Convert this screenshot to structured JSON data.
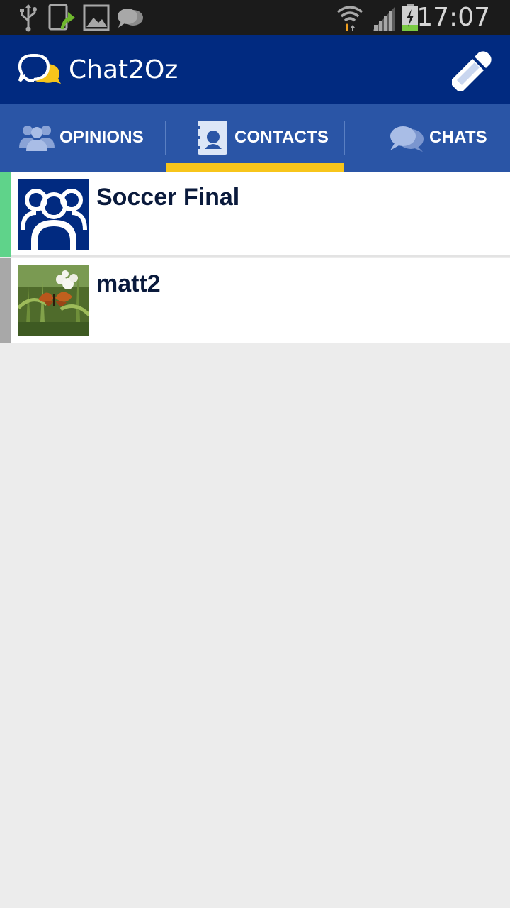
{
  "status_bar": {
    "time": "17:07",
    "left_icons": [
      "usb-icon",
      "screen-share-icon",
      "gallery-icon",
      "chat-notification-icon"
    ],
    "right_icons": [
      "wifi-icon",
      "signal-icon",
      "battery-charging-icon"
    ]
  },
  "app_bar": {
    "title": "Chat2Oz",
    "logo_icon": "chat-bubbles-logo-icon",
    "compose_icon": "pencil-icon"
  },
  "tabs": [
    {
      "label": "OPINIONS",
      "icon": "people-icon",
      "selected": false
    },
    {
      "label": "CONTACTS",
      "icon": "address-book-icon",
      "selected": true
    },
    {
      "label": "CHATS",
      "icon": "chat-bubbles-icon",
      "selected": false
    }
  ],
  "contacts": [
    {
      "name": "Soccer Final",
      "avatar": "group-avatar",
      "status_color": "#5fd38a"
    },
    {
      "name": "matt2",
      "avatar": "photo-avatar-butterfly",
      "status_color": "#a8a8a8"
    }
  ],
  "colors": {
    "status_bar": "#1b1b1b",
    "app_bar": "#012a80",
    "tab_bar": "#2a55a6",
    "tab_indicator": "#f7c51b",
    "background": "#ececec"
  }
}
